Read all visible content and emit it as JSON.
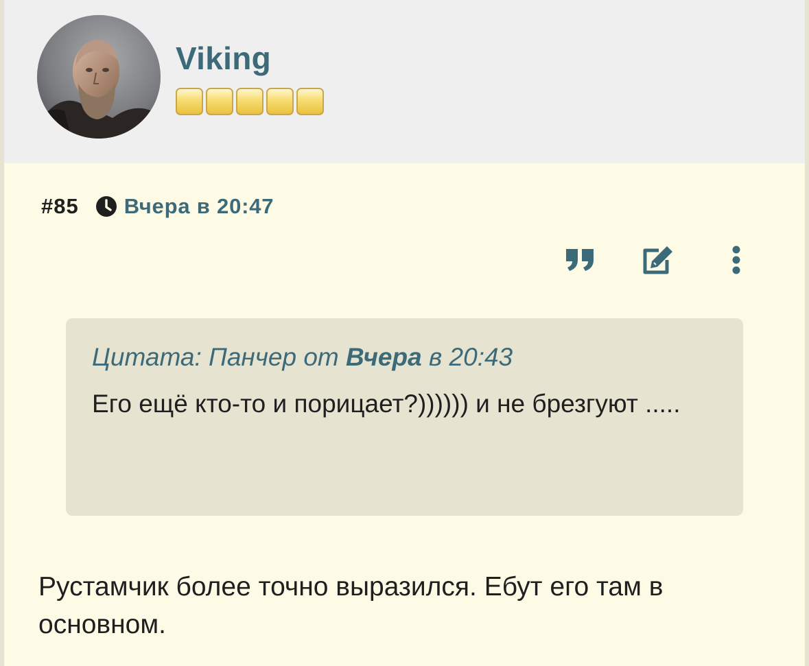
{
  "author": {
    "name": "Viking",
    "rank_stars": 5
  },
  "post": {
    "number": "#85",
    "time": "Вчера в 20:47",
    "body": "Рустамчик более точно выразился. Ебут его там в основном."
  },
  "quote": {
    "label": "Цитата: Панчер от ",
    "date_bold": "Вчера",
    "date_rest": " в 20:43",
    "text": "Его ещё кто-то и порицает?)))))) и не брезгуют ....."
  },
  "actions": {
    "quote_icon": "quote-icon",
    "edit_icon": "edit-icon",
    "more_icon": "vertical-ellipsis-icon"
  },
  "colors": {
    "accent": "#3d6a79",
    "background": "#fdfbe6",
    "header_bg": "#efeff0",
    "quote_bg": "#e6e3d0",
    "text": "#1f1f1f"
  }
}
